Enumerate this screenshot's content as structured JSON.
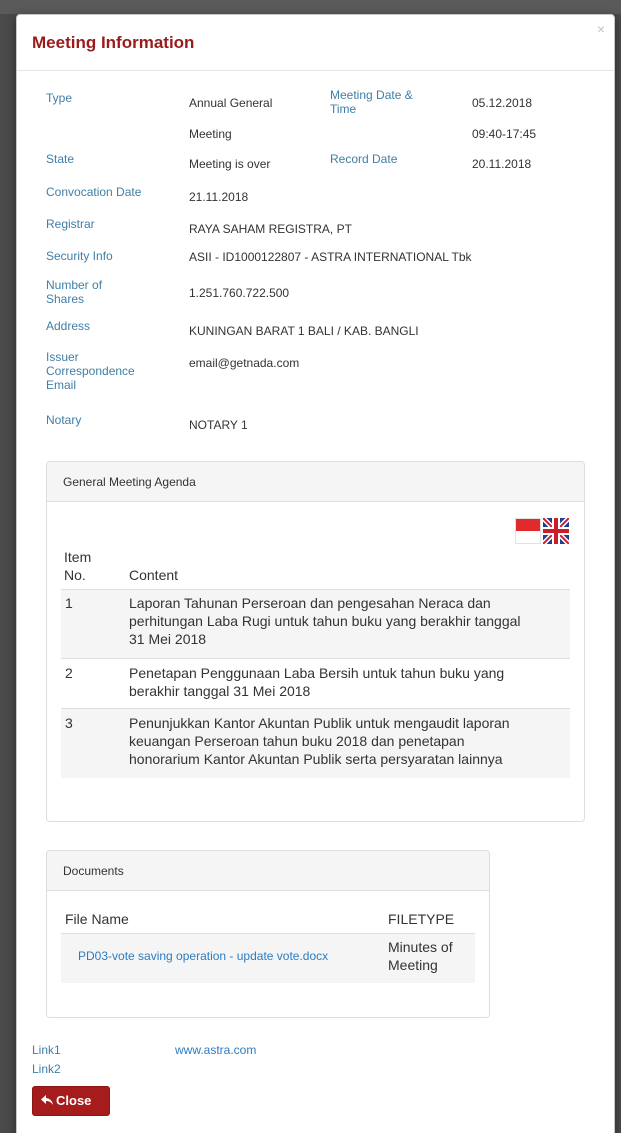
{
  "modal": {
    "title": "Meeting Information",
    "close_glyph": "×"
  },
  "info": {
    "type_label": "Type",
    "type_value_1": "Annual General",
    "type_value_2": "Meeting",
    "meeting_date_label_1": "Meeting Date &",
    "meeting_date_label_2": "Time",
    "meeting_date": "05.12.2018",
    "meeting_time": "09:40-17:45",
    "state_label": "State",
    "state_value": "Meeting is over",
    "record_date_label": "Record Date",
    "record_date": "20.11.2018",
    "convocation_label": "Convocation Date",
    "convocation_value": "21.11.2018",
    "registrar_label": "Registrar",
    "registrar_value": "RAYA SAHAM REGISTRA, PT",
    "security_label": "Security Info",
    "security_value": "ASII - ID1000122807 - ASTRA INTERNATIONAL Tbk",
    "shares_label_1": "Number of",
    "shares_label_2": "Shares",
    "shares_value": "1.251.760.722.500",
    "address_label": "Address",
    "address_value": "KUNINGAN BARAT 1 BALI / KAB. BANGLI",
    "email_label_1": "Issuer",
    "email_label_2": "Correspondence",
    "email_label_3": "Email",
    "email_value": "email@getnada.com",
    "notary_label": "Notary",
    "notary_value": "NOTARY 1"
  },
  "agenda": {
    "heading": "General Meeting Agenda",
    "col_item_1": "Item",
    "col_item_2": "No.",
    "col_content": "Content",
    "rows": [
      {
        "no": "1",
        "lines": [
          "Laporan Tahunan Perseroan dan pengesahan Neraca dan",
          "perhitungan Laba Rugi untuk tahun buku yang berakhir tanggal",
          "31 Mei 2018"
        ]
      },
      {
        "no": "2",
        "lines": [
          "Penetapan Penggunaan Laba Bersih untuk tahun buku yang",
          "berakhir tanggal 31 Mei 2018"
        ]
      },
      {
        "no": "3",
        "lines": [
          "Penunjukkan Kantor Akuntan Publik untuk mengaudit laporan",
          "keuangan Perseroan tahun buku 2018 dan penetapan",
          "honorarium Kantor Akuntan Publik serta persyaratan lainnya"
        ]
      }
    ]
  },
  "documents": {
    "heading": "Documents",
    "col_file_name": "File Name",
    "col_filetype": "FILETYPE",
    "file_name": "PD03-vote saving operation - update vote.docx",
    "filetype_1": "Minutes of",
    "filetype_2": "Meeting"
  },
  "links": {
    "link1_label": "Link1",
    "link1_value": "www.astra.com",
    "link2_label": "Link2"
  },
  "footer": {
    "close_label": "Close"
  },
  "colors": {
    "title_red": "#9a1b1b",
    "label_blue": "#3f7fa6",
    "link_blue": "#2d7cc0",
    "button_red": "#a61c1c"
  }
}
